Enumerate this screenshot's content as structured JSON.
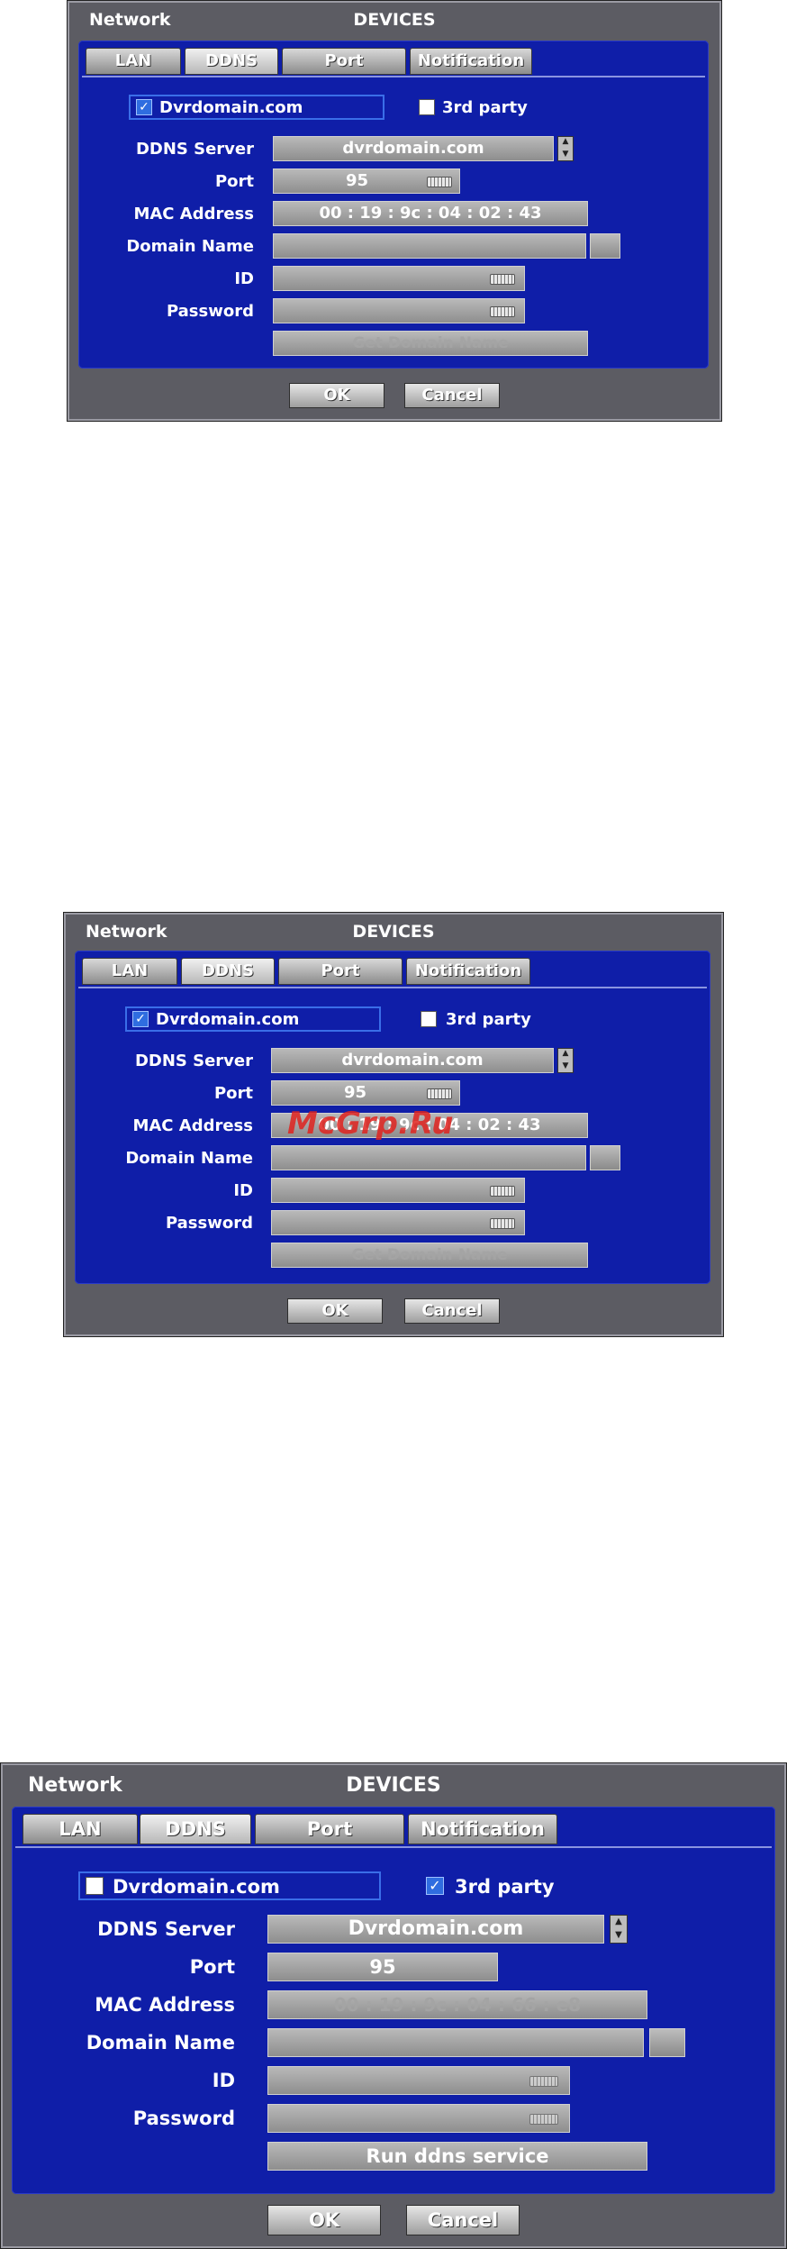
{
  "dialogs": [
    {
      "title_left": "Network",
      "title_center": "DEVICES",
      "tabs": [
        "LAN",
        "DDNS",
        "Port",
        "Notification"
      ],
      "active_tab": "DDNS",
      "option_dvrdomain": {
        "label": "Dvrdomain.com",
        "checked": true
      },
      "option_third_party": {
        "label": "3rd party",
        "checked": false
      },
      "labels": {
        "ddns_server": "DDNS Server",
        "port": "Port",
        "mac": "MAC Address",
        "domain": "Domain Name",
        "id": "ID",
        "password": "Password"
      },
      "values": {
        "ddns_server": "dvrdomain.com",
        "port": "95",
        "mac": "00 : 19 : 9c : 04 : 02 : 43",
        "domain": "",
        "id": "",
        "password": ""
      },
      "action_button": "Get Domain Name",
      "ok": "OK",
      "cancel": "Cancel"
    },
    {
      "title_left": "Network",
      "title_center": "DEVICES",
      "tabs": [
        "LAN",
        "DDNS",
        "Port",
        "Notification"
      ],
      "active_tab": "DDNS",
      "option_dvrdomain": {
        "label": "Dvrdomain.com",
        "checked": true
      },
      "option_third_party": {
        "label": "3rd party",
        "checked": false
      },
      "labels": {
        "ddns_server": "DDNS Server",
        "port": "Port",
        "mac": "MAC Address",
        "domain": "Domain Name",
        "id": "ID",
        "password": "Password"
      },
      "values": {
        "ddns_server": "dvrdomain.com",
        "port": "95",
        "mac": "00 : 19 : 9c : 04 : 02 : 43",
        "domain": "",
        "id": "",
        "password": ""
      },
      "action_button": "Get Domain Name",
      "ok": "OK",
      "cancel": "Cancel",
      "watermark": "McGrp.Ru"
    },
    {
      "title_left": "Network",
      "title_center": "DEVICES",
      "tabs": [
        "LAN",
        "DDNS",
        "Port",
        "Notification"
      ],
      "active_tab": "DDNS",
      "option_dvrdomain": {
        "label": "Dvrdomain.com",
        "checked": false
      },
      "option_third_party": {
        "label": "3rd party",
        "checked": true
      },
      "labels": {
        "ddns_server": "DDNS Server",
        "port": "Port",
        "mac": "MAC Address",
        "domain": "Domain Name",
        "id": "ID",
        "password": "Password"
      },
      "values": {
        "ddns_server": "Dvrdomain.com",
        "port": "95",
        "mac": "00 : 19 : 9c : 04 : 66 : e8",
        "domain": "",
        "id": "",
        "password": ""
      },
      "action_button": "Run ddns service",
      "ok": "OK",
      "cancel": "Cancel"
    }
  ],
  "colors": {
    "panel": "#0f1ea8",
    "frame": "#5c5c63",
    "checkbox_border": "#3a6ee8",
    "watermark": "#e0231f"
  },
  "icons": {
    "keyboard": "keyboard-icon",
    "spinner": "spinner-arrows-icon",
    "check": "check-icon",
    "browse": "ellipsis-button-icon"
  }
}
